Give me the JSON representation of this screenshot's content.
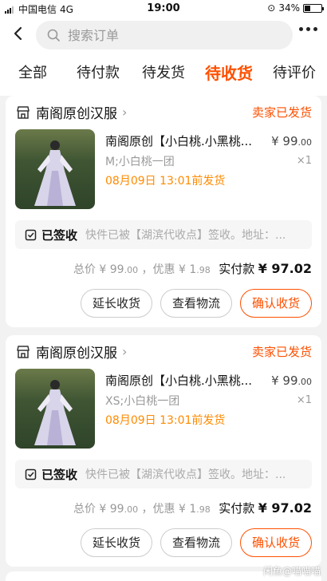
{
  "status_bar": {
    "carrier": "中国电信",
    "network": "4G",
    "time": "19:00",
    "battery": "34%",
    "battery_level": 0.34
  },
  "search": {
    "placeholder": "搜索订单"
  },
  "tabs": [
    {
      "label": "全部",
      "active": false
    },
    {
      "label": "待付款",
      "active": false
    },
    {
      "label": "待发货",
      "active": false
    },
    {
      "label": "待收货",
      "active": true
    },
    {
      "label": "待评价",
      "active": false
    }
  ],
  "orders": [
    {
      "shop": "南阁原创汉服",
      "status": "卖家已发货",
      "title": "南阁原创【小白桃.小黑桃...",
      "spec": "M;小白桃一团",
      "deadline": "08月09日 13:01前发货",
      "price_int": "¥ 99",
      "price_dec": ".00",
      "qty": "×1",
      "logistics_status": "已签收",
      "logistics_detail": "快件已被【湖滨代收点】签收。地址：...",
      "total_label": "总价",
      "total_int": "¥ 99",
      "total_dec": ".00",
      "discount_label": "，优惠",
      "discount_int": "¥ 1",
      "discount_dec": ".98",
      "paid_label": "实付款",
      "paid_int": "¥ 97",
      "paid_dec": ".02",
      "btn_extend": "延长收货",
      "btn_logistics": "查看物流",
      "btn_confirm": "确认收货"
    },
    {
      "shop": "南阁原创汉服",
      "status": "卖家已发货",
      "title": "南阁原创【小白桃.小黑桃...",
      "spec": "XS;小白桃一团",
      "deadline": "08月09日 13:01前发货",
      "price_int": "¥ 99",
      "price_dec": ".00",
      "qty": "×1",
      "logistics_status": "已签收",
      "logistics_detail": "快件已被【湖滨代收点】签收。地址：...",
      "total_label": "总价",
      "total_int": "¥ 99",
      "total_dec": ".00",
      "discount_label": "，优惠",
      "discount_int": "¥ 1",
      "discount_dec": ".98",
      "paid_label": "实付款",
      "paid_int": "¥ 97",
      "paid_dec": ".02",
      "btn_extend": "延长收货",
      "btn_logistics": "查看物流",
      "btn_confirm": "确认收货"
    }
  ],
  "watermark": "闲鱼@喵喵喵",
  "colors": {
    "accent": "#ff5000",
    "deadline": "#ff8a00"
  },
  "icons": [
    "back-arrow-icon",
    "search-icon",
    "more-icon",
    "shop-icon",
    "chevron-right-icon",
    "signed-check-icon"
  ]
}
